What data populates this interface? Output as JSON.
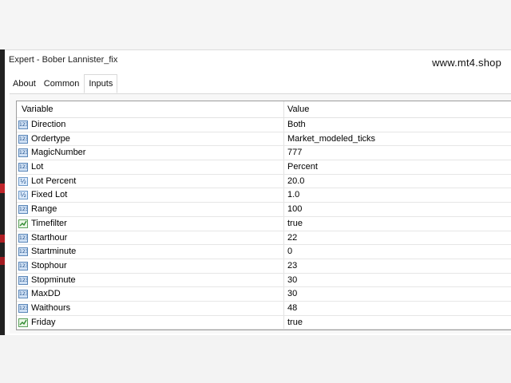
{
  "window": {
    "title": "Expert - Bober Lannister_fix",
    "watermark": "www.mt4.shop"
  },
  "tabs": [
    {
      "label": "About",
      "active": false
    },
    {
      "label": "Common",
      "active": false
    },
    {
      "label": "Inputs",
      "active": true
    }
  ],
  "table": {
    "headers": {
      "variable": "Variable",
      "value": "Value"
    },
    "rows": [
      {
        "variable": "Direction",
        "value": "Both",
        "icon": "integer-icon"
      },
      {
        "variable": "Ordertype",
        "value": "Market_modeled_ticks",
        "icon": "integer-icon"
      },
      {
        "variable": "MagicNumber",
        "value": "777",
        "icon": "integer-icon"
      },
      {
        "variable": "Lot",
        "value": "Percent",
        "icon": "integer-icon"
      },
      {
        "variable": "Lot Percent",
        "value": "20.0",
        "icon": "fraction-icon"
      },
      {
        "variable": "Fixed Lot",
        "value": "1.0",
        "icon": "fraction-icon"
      },
      {
        "variable": "Range",
        "value": "100",
        "icon": "integer-icon"
      },
      {
        "variable": "Timefilter",
        "value": "true",
        "icon": "boolean-icon"
      },
      {
        "variable": "Starthour",
        "value": "22",
        "icon": "integer-icon"
      },
      {
        "variable": "Startminute",
        "value": "0",
        "icon": "integer-icon"
      },
      {
        "variable": "Stophour",
        "value": "23",
        "icon": "integer-icon"
      },
      {
        "variable": "Stopminute",
        "value": "30",
        "icon": "integer-icon"
      },
      {
        "variable": "MaxDD",
        "value": "30",
        "icon": "integer-icon"
      },
      {
        "variable": "Waithours",
        "value": "48",
        "icon": "integer-icon"
      },
      {
        "variable": "Friday",
        "value": "true",
        "icon": "boolean-icon"
      }
    ]
  },
  "icon_glyphs": {
    "integer": "123",
    "fraction": "½"
  }
}
